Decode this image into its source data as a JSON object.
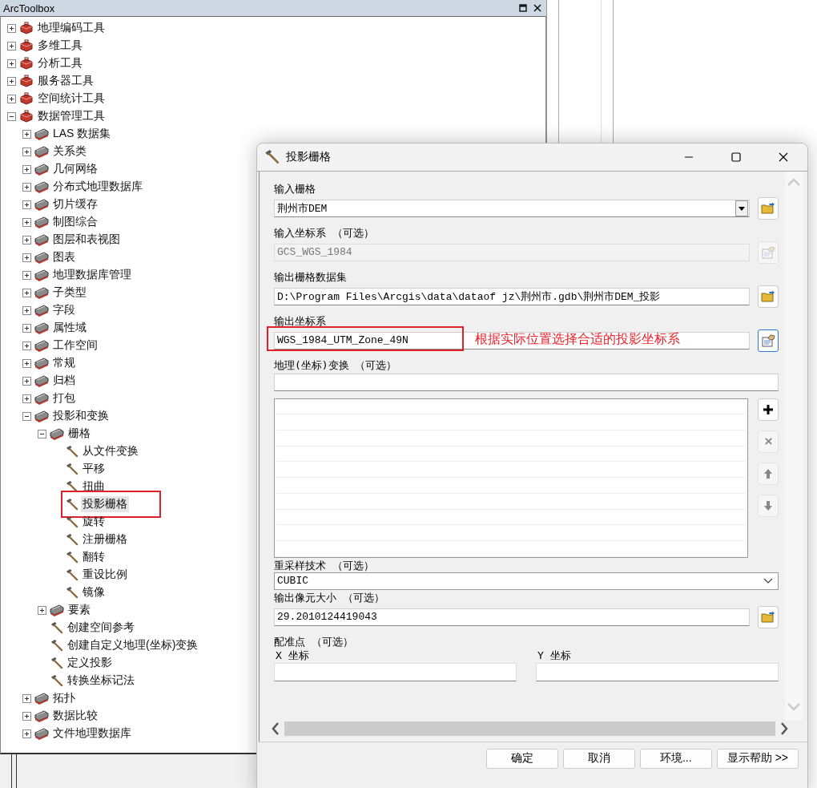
{
  "toolbox_panel": {
    "title": "ArcToolbox",
    "tree": [
      {
        "label": "地理编码工具",
        "kind": "toolbox",
        "expanded": false,
        "selected": false,
        "marked": false
      },
      {
        "label": "多维工具",
        "kind": "toolbox",
        "expanded": false,
        "selected": false,
        "marked": false
      },
      {
        "label": "分析工具",
        "kind": "toolbox",
        "expanded": false,
        "selected": false,
        "marked": false
      },
      {
        "label": "服务器工具",
        "kind": "toolbox",
        "expanded": false,
        "selected": false,
        "marked": false
      },
      {
        "label": "空间统计工具",
        "kind": "toolbox",
        "expanded": false,
        "selected": false,
        "marked": false
      },
      {
        "label": "数据管理工具",
        "kind": "toolbox",
        "expanded": true,
        "selected": false,
        "marked": false,
        "children": [
          {
            "label": "LAS 数据集",
            "kind": "toolset",
            "expanded": false,
            "selected": false,
            "marked": false
          },
          {
            "label": "关系类",
            "kind": "toolset",
            "expanded": false,
            "selected": false,
            "marked": false
          },
          {
            "label": "几何网络",
            "kind": "toolset",
            "expanded": false,
            "selected": false,
            "marked": false
          },
          {
            "label": "分布式地理数据库",
            "kind": "toolset",
            "expanded": false,
            "selected": false,
            "marked": false
          },
          {
            "label": "切片缓存",
            "kind": "toolset",
            "expanded": false,
            "selected": false,
            "marked": false
          },
          {
            "label": "制图综合",
            "kind": "toolset",
            "expanded": false,
            "selected": false,
            "marked": false
          },
          {
            "label": "图层和表视图",
            "kind": "toolset",
            "expanded": false,
            "selected": false,
            "marked": false
          },
          {
            "label": "图表",
            "kind": "toolset",
            "expanded": false,
            "selected": false,
            "marked": false
          },
          {
            "label": "地理数据库管理",
            "kind": "toolset",
            "expanded": false,
            "selected": false,
            "marked": false
          },
          {
            "label": "子类型",
            "kind": "toolset",
            "expanded": false,
            "selected": false,
            "marked": false
          },
          {
            "label": "字段",
            "kind": "toolset",
            "expanded": false,
            "selected": false,
            "marked": false
          },
          {
            "label": "属性域",
            "kind": "toolset",
            "expanded": false,
            "selected": false,
            "marked": false
          },
          {
            "label": "工作空间",
            "kind": "toolset",
            "expanded": false,
            "selected": false,
            "marked": false
          },
          {
            "label": "常规",
            "kind": "toolset",
            "expanded": false,
            "selected": false,
            "marked": false
          },
          {
            "label": "归档",
            "kind": "toolset",
            "expanded": false,
            "selected": false,
            "marked": false
          },
          {
            "label": "打包",
            "kind": "toolset",
            "expanded": false,
            "selected": false,
            "marked": false
          },
          {
            "label": "投影和变换",
            "kind": "toolset",
            "expanded": true,
            "selected": false,
            "marked": false,
            "children": [
              {
                "label": "栅格",
                "kind": "toolset",
                "expanded": true,
                "selected": false,
                "marked": false,
                "children": [
                  {
                    "label": "从文件变换",
                    "kind": "tool",
                    "selected": false,
                    "marked": false
                  },
                  {
                    "label": "平移",
                    "kind": "tool",
                    "selected": false,
                    "marked": false
                  },
                  {
                    "label": "扭曲",
                    "kind": "tool",
                    "selected": false,
                    "marked": false
                  },
                  {
                    "label": "投影栅格",
                    "kind": "tool",
                    "selected": true,
                    "marked": true
                  },
                  {
                    "label": "旋转",
                    "kind": "tool",
                    "selected": false,
                    "marked": false
                  },
                  {
                    "label": "注册栅格",
                    "kind": "tool",
                    "selected": false,
                    "marked": false
                  },
                  {
                    "label": "翻转",
                    "kind": "tool",
                    "selected": false,
                    "marked": false
                  },
                  {
                    "label": "重设比例",
                    "kind": "tool",
                    "selected": false,
                    "marked": false
                  },
                  {
                    "label": "镜像",
                    "kind": "tool",
                    "selected": false,
                    "marked": false
                  }
                ]
              },
              {
                "label": "要素",
                "kind": "toolset",
                "expanded": false,
                "selected": false,
                "marked": false
              },
              {
                "label": "创建空间参考",
                "kind": "tool",
                "selected": false,
                "marked": false
              },
              {
                "label": "创建自定义地理(坐标)变换",
                "kind": "tool",
                "selected": false,
                "marked": false
              },
              {
                "label": "定义投影",
                "kind": "tool",
                "selected": false,
                "marked": false
              },
              {
                "label": "转换坐标记法",
                "kind": "tool",
                "selected": false,
                "marked": false
              }
            ]
          },
          {
            "label": "拓扑",
            "kind": "toolset",
            "expanded": false,
            "selected": false,
            "marked": false
          },
          {
            "label": "数据比较",
            "kind": "toolset",
            "expanded": false,
            "selected": false,
            "marked": false
          },
          {
            "label": "文件地理数据库",
            "kind": "toolset",
            "expanded": false,
            "selected": false,
            "marked": false
          }
        ]
      }
    ]
  },
  "dialog": {
    "title": "投影栅格",
    "params": [
      {
        "kind": "combo",
        "label": "输入栅格",
        "value": "荆州市DEM",
        "disabled": false,
        "browse": {
          "kind": "folder"
        }
      },
      {
        "kind": "text",
        "label": "输入坐标系 （可选）",
        "value": "GCS_WGS_1984",
        "disabled": true,
        "browse": {
          "kind": "sheet"
        }
      },
      {
        "kind": "text",
        "label": "输出栅格数据集",
        "value": "D:\\Program Files\\Arcgis\\data\\dataof jz\\荆州市.gdb\\荆州市DEM_投影",
        "disabled": false,
        "browse": {
          "kind": "folder"
        }
      },
      {
        "kind": "text",
        "label": "输出坐标系",
        "value": "WGS_1984_UTM_Zone_49N",
        "disabled": false,
        "browse": {
          "kind": "sheet"
        },
        "annotation": "根据实际位置选择合适的投影坐标系"
      },
      {
        "kind": "text",
        "label": "地理(坐标)变换 （可选）",
        "disabled": false
      },
      {
        "kind": "list",
        "buttons": [
          {
            "kind": "plus",
            "disabled": false
          },
          {
            "kind": "remove",
            "disabled": true
          },
          {
            "kind": "up",
            "disabled": true
          },
          {
            "kind": "down",
            "disabled": true
          }
        ]
      },
      {
        "kind": "dropdown",
        "label": "重采样技术 （可选）",
        "value": "CUBIC"
      },
      {
        "kind": "text",
        "label": "输出像元大小 （可选）",
        "value": "29.2010124419043",
        "disabled": false,
        "browse": {
          "kind": "folder"
        }
      },
      {
        "kind": "xy",
        "label": "配准点 （可选）",
        "columns": [
          "X 坐标",
          "Y 坐标"
        ]
      }
    ],
    "buttons": [
      "确定",
      "取消",
      "环境...",
      "显示帮助 >>"
    ]
  }
}
